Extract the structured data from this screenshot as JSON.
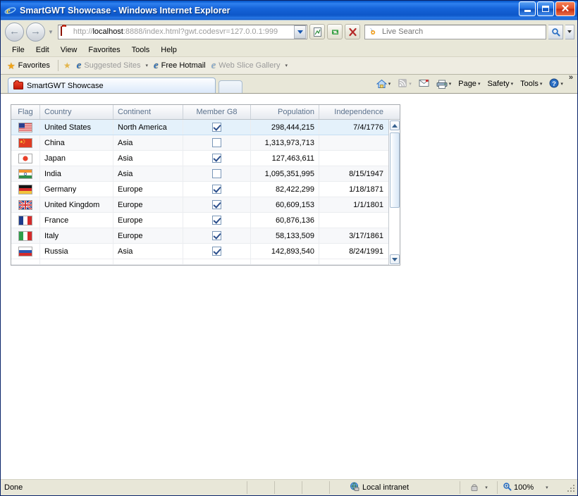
{
  "window": {
    "title": "SmartGWT Showcase - Windows Internet Explorer",
    "minimize_label": "Minimize",
    "maximize_label": "Maximize",
    "close_label": "Close"
  },
  "nav": {
    "back_glyph": "←",
    "forward_glyph": "→",
    "recent_pages_caret": "▼"
  },
  "address": {
    "scheme": "http://",
    "host": "localhost",
    "rest": ":8888/index.html?gwt.codesvr=127.0.0.1:999",
    "full": "http://localhost:8888/index.html?gwt.codesvr=127.0.0.1:999",
    "compat_label": "Compatibility View",
    "refresh_label": "Refresh",
    "stop_label": "Stop"
  },
  "search": {
    "placeholder": "Live Search",
    "go_label": "Search",
    "options_caret": "▼"
  },
  "menu": {
    "items": [
      "File",
      "Edit",
      "View",
      "Favorites",
      "Tools",
      "Help"
    ]
  },
  "favorites_bar": {
    "favorites_label": "Favorites",
    "items": [
      {
        "label": "Suggested Sites",
        "dimmed": true,
        "caret": "▾"
      },
      {
        "label": "Free Hotmail",
        "dimmed": false,
        "caret": ""
      },
      {
        "label": "Web Slice Gallery",
        "dimmed": true,
        "caret": "▾"
      }
    ]
  },
  "tabs": {
    "items": [
      {
        "label": "SmartGWT Showcase",
        "active": true
      }
    ],
    "new_tab_label": ""
  },
  "command_bar": {
    "items": [
      {
        "label": "",
        "icon": "home-icon",
        "caret": "▾"
      },
      {
        "label": "",
        "icon": "feeds-icon",
        "caret": "▾"
      },
      {
        "label": "",
        "icon": "mail-icon",
        "caret": ""
      },
      {
        "label": "",
        "icon": "print-icon",
        "caret": "▾"
      },
      {
        "label": "Page",
        "icon": "",
        "caret": "▾"
      },
      {
        "label": "Safety",
        "icon": "",
        "caret": "▾"
      },
      {
        "label": "Tools",
        "icon": "",
        "caret": "▾"
      },
      {
        "label": "",
        "icon": "help-icon",
        "caret": "▾"
      }
    ],
    "overflow": "»"
  },
  "grid": {
    "columns": [
      {
        "key": "flag",
        "label": "Flag",
        "align": "center"
      },
      {
        "key": "country",
        "label": "Country",
        "align": "left"
      },
      {
        "key": "continent",
        "label": "Continent",
        "align": "left"
      },
      {
        "key": "member_g8",
        "label": "Member G8",
        "align": "center"
      },
      {
        "key": "population",
        "label": "Population",
        "align": "right"
      },
      {
        "key": "independence",
        "label": "Independence",
        "align": "right"
      }
    ],
    "rows": [
      {
        "flag": "us",
        "country": "United States",
        "continent": "North America",
        "member_g8": true,
        "population": "298,444,215",
        "independence": "7/4/1776",
        "selected": true
      },
      {
        "flag": "cn",
        "country": "China",
        "continent": "Asia",
        "member_g8": false,
        "population": "1,313,973,713",
        "independence": "",
        "selected": false
      },
      {
        "flag": "jp",
        "country": "Japan",
        "continent": "Asia",
        "member_g8": true,
        "population": "127,463,611",
        "independence": "",
        "selected": false
      },
      {
        "flag": "in",
        "country": "India",
        "continent": "Asia",
        "member_g8": false,
        "population": "1,095,351,995",
        "independence": "8/15/1947",
        "selected": false
      },
      {
        "flag": "de",
        "country": "Germany",
        "continent": "Europe",
        "member_g8": true,
        "population": "82,422,299",
        "independence": "1/18/1871",
        "selected": false
      },
      {
        "flag": "gb",
        "country": "United Kingdom",
        "continent": "Europe",
        "member_g8": true,
        "population": "60,609,153",
        "independence": "1/1/1801",
        "selected": false
      },
      {
        "flag": "fr",
        "country": "France",
        "continent": "Europe",
        "member_g8": true,
        "population": "60,876,136",
        "independence": "",
        "selected": false
      },
      {
        "flag": "it",
        "country": "Italy",
        "continent": "Europe",
        "member_g8": true,
        "population": "58,133,509",
        "independence": "3/17/1861",
        "selected": false
      },
      {
        "flag": "ru",
        "country": "Russia",
        "continent": "Asia",
        "member_g8": true,
        "population": "142,893,540",
        "independence": "8/24/1991",
        "selected": false
      }
    ],
    "scroll_up_label": "Scroll up",
    "scroll_down_label": "Scroll down"
  },
  "status_bar": {
    "message": "Done",
    "zone": "Local intranet",
    "zone_caret": "▾",
    "protected_caret": "▾",
    "zoom": "100%",
    "zoom_caret": "▾"
  },
  "colors": {
    "title_blue": "#0f62d6",
    "chrome": "#e8e7d8",
    "header_text": "#5b718c",
    "row_selected": "#e4f1fb",
    "row_alt": "#f7f8fa"
  }
}
